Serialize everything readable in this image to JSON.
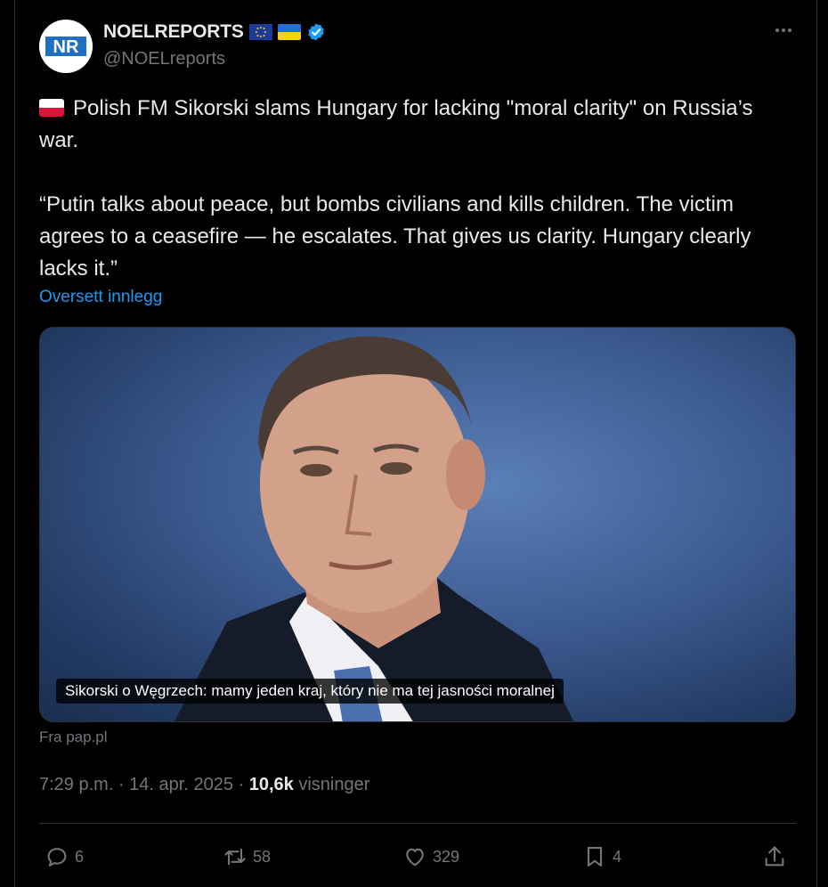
{
  "author": {
    "display_name": "NOELREPORTS",
    "handle": "@NOELreports",
    "avatar_text": "NR",
    "verified": true
  },
  "tweet": {
    "line1": "Polish FM Sikorski slams Hungary for lacking \"moral clarity\" on Russia’s war.",
    "quote": "“Putin talks about peace, but bombs civilians and kills children. The victim agrees to a ceasefire — he escalates. That gives us clarity. Hungary clearly lacks it.”",
    "translate_label": "Oversett innlegg"
  },
  "card": {
    "caption": "Sikorski o Węgrzech: mamy jeden kraj, który nie ma tej jasności moralnej",
    "source": "Fra pap.pl"
  },
  "meta": {
    "time": "7:29 p.m.",
    "date": "14. apr. 2025",
    "views": "10,6k",
    "views_label": "visninger"
  },
  "actions": {
    "replies": "6",
    "reposts": "58",
    "likes": "329",
    "bookmarks": "4"
  },
  "colors": {
    "background": "#000000",
    "text": "#e7e9ea",
    "muted": "#71767b",
    "link": "#1d9bf0",
    "border": "#2f3336"
  }
}
